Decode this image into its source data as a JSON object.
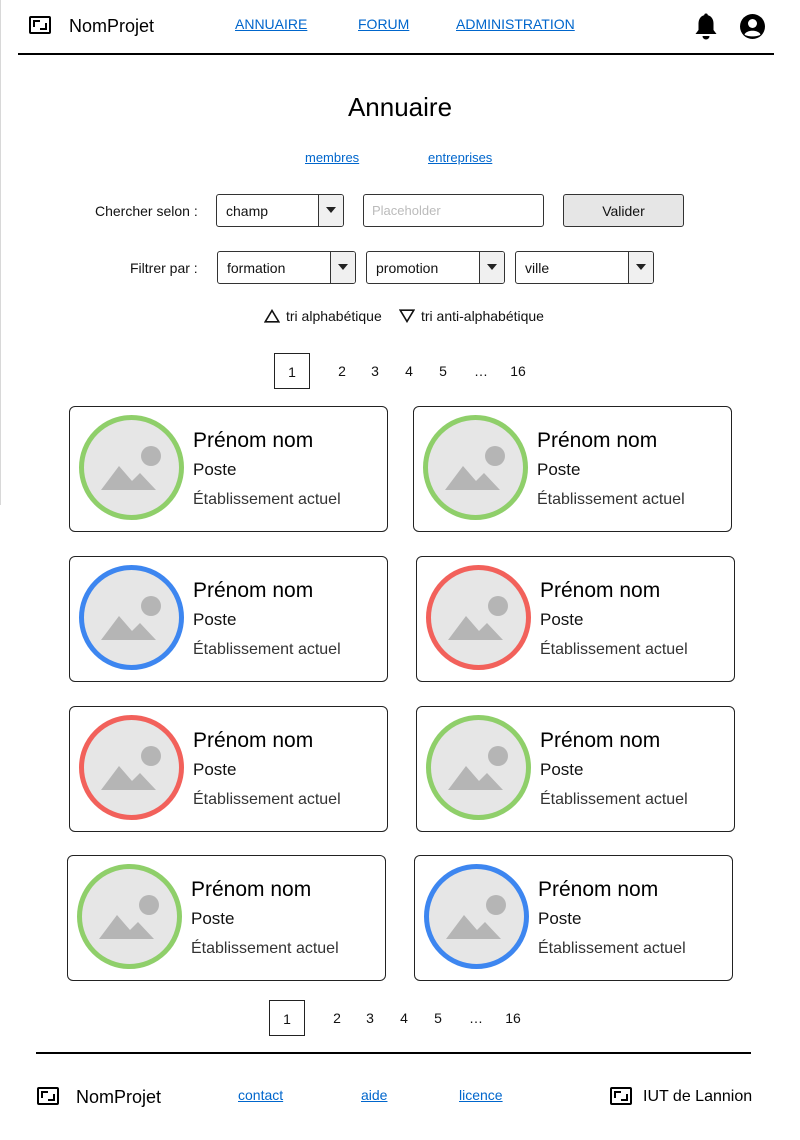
{
  "header": {
    "brand": "NomProjet",
    "nav": [
      "ANNUAIRE",
      "FORUM",
      "ADMINISTRATION"
    ],
    "icons": [
      "bell-icon",
      "account-icon"
    ]
  },
  "page": {
    "title": "Annuaire",
    "tabs": [
      "membres",
      "entreprises"
    ]
  },
  "search": {
    "label": "Chercher selon :",
    "field_select": "champ",
    "placeholder": "Placeholder",
    "submit": "Valider"
  },
  "filter": {
    "label": "Filtrer par :",
    "selects": [
      "formation",
      "promotion",
      "ville"
    ]
  },
  "sort": {
    "asc": "tri alphabétique",
    "desc": "tri anti-alphabétique"
  },
  "pagination": [
    "1",
    "2",
    "3",
    "4",
    "5",
    "…",
    "16"
  ],
  "pagination_active": "1",
  "cards": [
    {
      "name": "Prénom nom",
      "poste": "Poste",
      "etablissement": "Établissement actuel",
      "ring_color": "#8fcf6a"
    },
    {
      "name": "Prénom nom",
      "poste": "Poste",
      "etablissement": "Établissement actuel",
      "ring_color": "#8fcf6a"
    },
    {
      "name": "Prénom nom",
      "poste": "Poste",
      "etablissement": "Établissement actuel",
      "ring_color": "#3d86f0"
    },
    {
      "name": "Prénom nom",
      "poste": "Poste",
      "etablissement": "Établissement actuel",
      "ring_color": "#f2615b"
    },
    {
      "name": "Prénom nom",
      "poste": "Poste",
      "etablissement": "Établissement actuel",
      "ring_color": "#f2615b"
    },
    {
      "name": "Prénom nom",
      "poste": "Poste",
      "etablissement": "Établissement actuel",
      "ring_color": "#8fcf6a"
    },
    {
      "name": "Prénom nom",
      "poste": "Poste",
      "etablissement": "Établissement actuel",
      "ring_color": "#8fcf6a"
    },
    {
      "name": "Prénom nom",
      "poste": "Poste",
      "etablissement": "Établissement actuel",
      "ring_color": "#3d86f0"
    }
  ],
  "footer": {
    "brand": "NomProjet",
    "links": [
      "contact",
      "aide",
      "licence"
    ],
    "partner": "IUT de Lannion"
  },
  "colors": {
    "link": "#0066cc",
    "ring_green": "#8fcf6a",
    "ring_blue": "#3d86f0",
    "ring_red": "#f2615b"
  }
}
